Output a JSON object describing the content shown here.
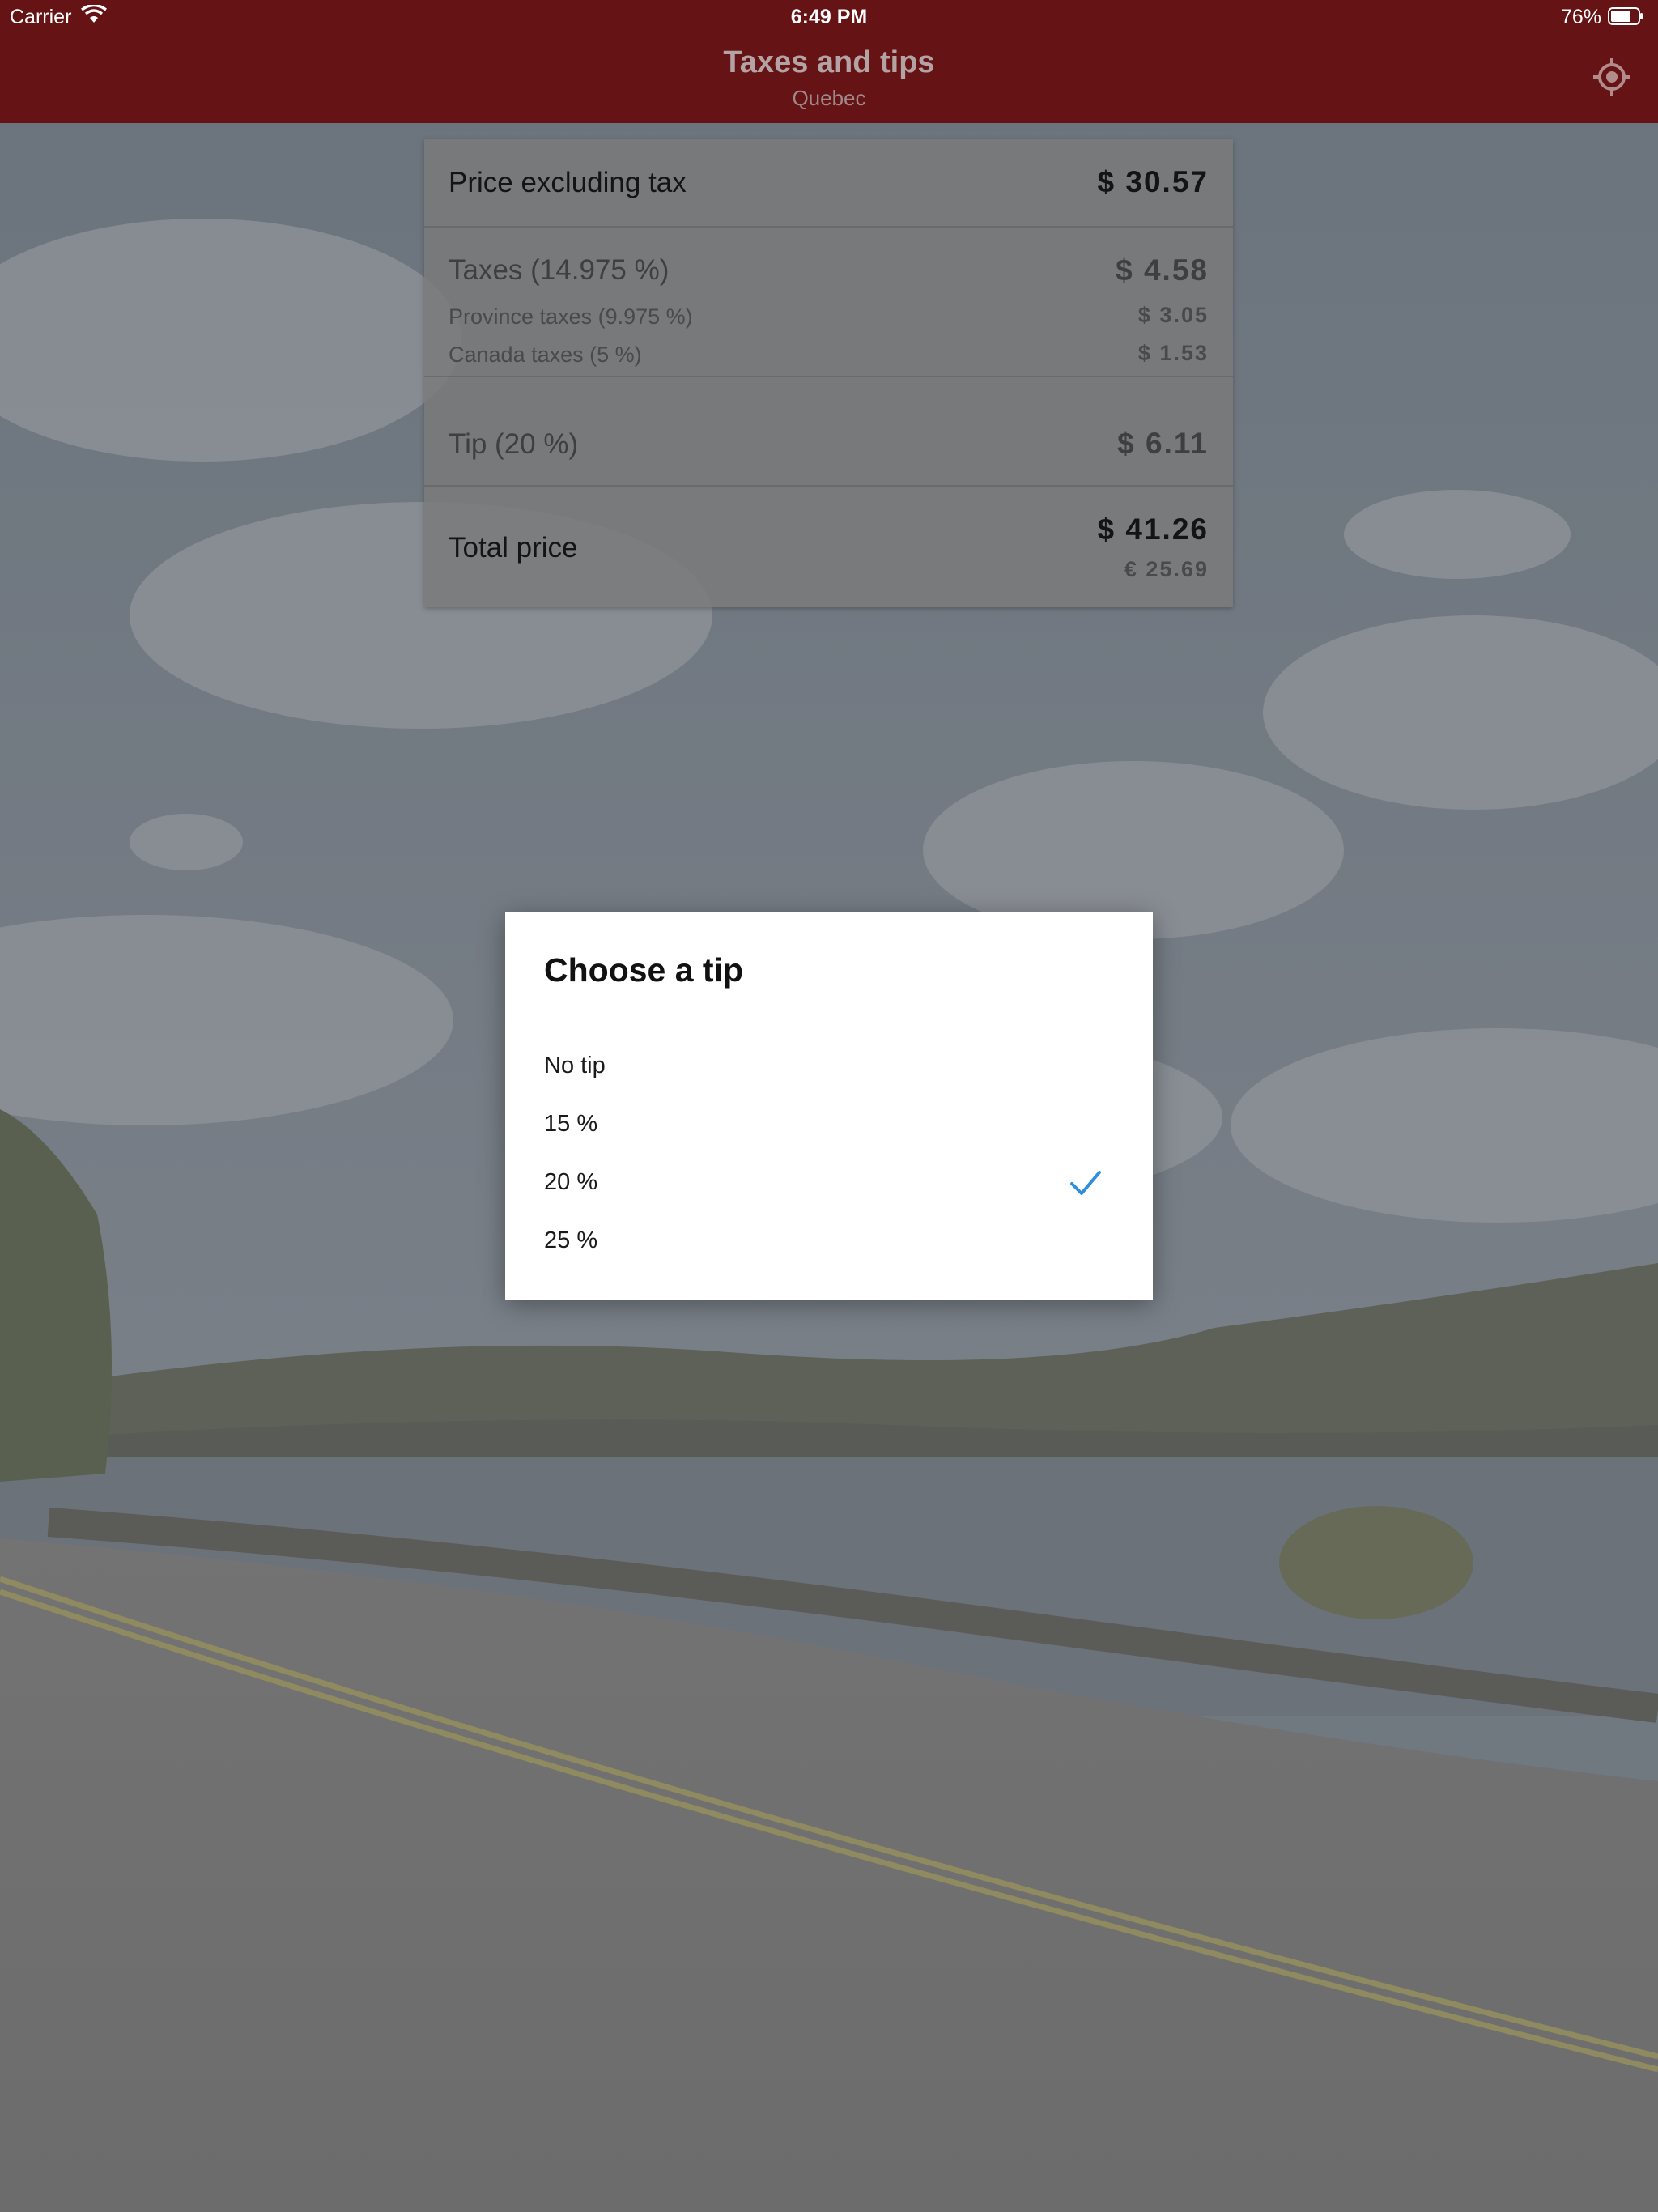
{
  "status_bar": {
    "carrier": "Carrier",
    "time": "6:49 PM",
    "battery_percent": "76%",
    "battery_level": 0.76
  },
  "nav": {
    "title": "Taxes and tips",
    "subtitle": "Quebec",
    "locate_icon": "location-target-icon"
  },
  "summary": {
    "price_excl": {
      "label": "Price excluding tax",
      "value": "$ 30.57"
    },
    "taxes": {
      "label": "Taxes (14.975 %)",
      "value": "$ 4.58",
      "province": {
        "label": "Province taxes (9.975 %)",
        "value": "$ 3.05"
      },
      "canada": {
        "label": "Canada taxes (5 %)",
        "value": "$ 1.53"
      }
    },
    "tip": {
      "label": "Tip (20 %)",
      "value": "$ 6.11"
    },
    "total": {
      "label": "Total price",
      "value": "$ 41.26",
      "value_eur": "€ 25.69"
    }
  },
  "dialog": {
    "title": "Choose a tip",
    "options": [
      {
        "label": "No tip",
        "selected": false
      },
      {
        "label": "15 %",
        "selected": false
      },
      {
        "label": "20 %",
        "selected": true
      },
      {
        "label": "25 %",
        "selected": false
      }
    ],
    "check_color": "#2f8fdd"
  },
  "colors": {
    "nav_bg": "#651315",
    "accent_check": "#2f8fdd"
  }
}
